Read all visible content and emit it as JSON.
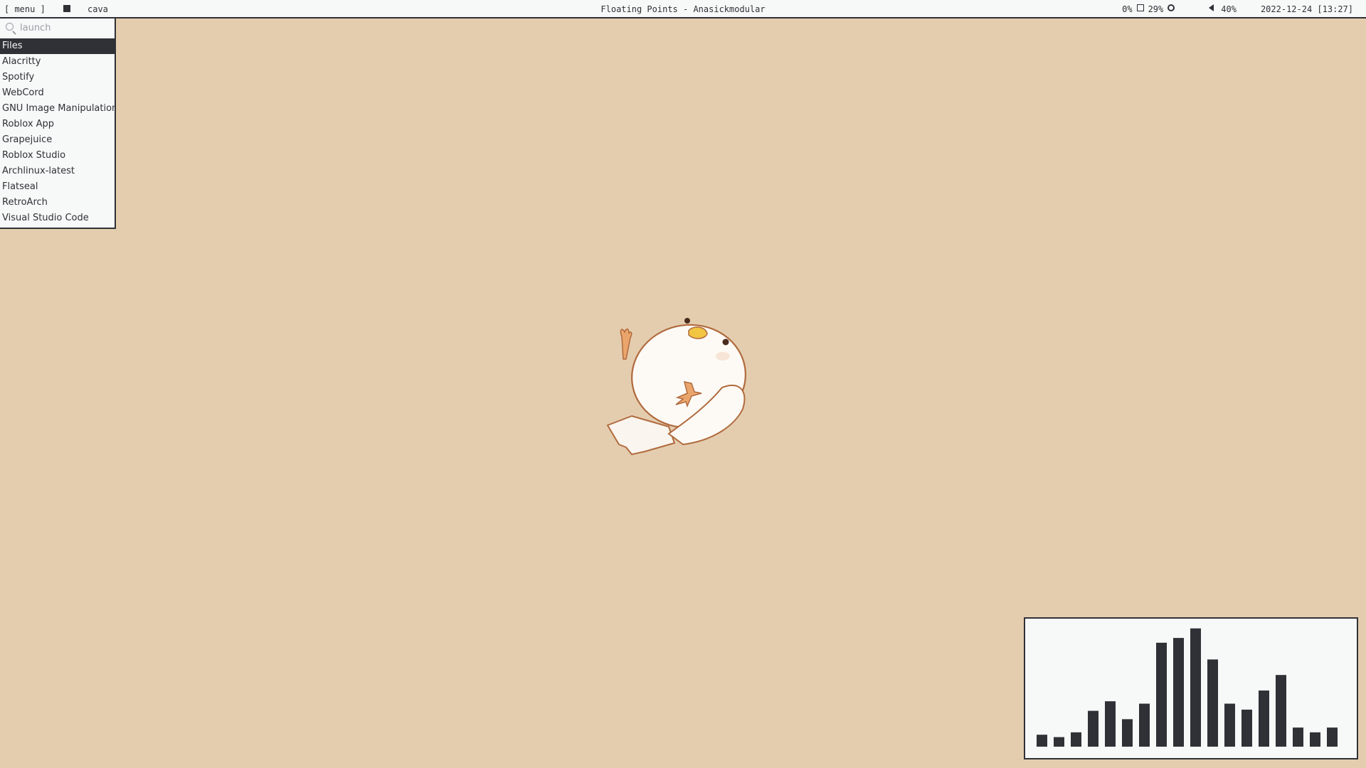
{
  "topbar": {
    "menu_label": "[ menu ]",
    "workspace_label": "cava",
    "now_playing": "Floating Points - Anasickmodular",
    "cpu": "0%",
    "memory": "29%",
    "volume": "40%",
    "datetime": "2022-12-24 [13:27]"
  },
  "launcher": {
    "search_placeholder": "launch",
    "items": [
      {
        "label": "Files",
        "selected": true
      },
      {
        "label": "Alacritty"
      },
      {
        "label": "Spotify"
      },
      {
        "label": "WebCord"
      },
      {
        "label": "GNU Image Manipulation Program"
      },
      {
        "label": "Roblox App"
      },
      {
        "label": "Grapejuice"
      },
      {
        "label": "Roblox Studio"
      },
      {
        "label": "Archlinux-latest"
      },
      {
        "label": "Flatseal"
      },
      {
        "label": "RetroArch"
      },
      {
        "label": "Visual Studio Code"
      }
    ]
  },
  "visualizer": {
    "bar_color": "#2f3136",
    "levels": [
      0.1,
      0.08,
      0.12,
      0.3,
      0.38,
      0.23,
      0.36,
      0.87,
      0.91,
      0.99,
      0.73,
      0.36,
      0.31,
      0.47,
      0.6,
      0.16,
      0.12,
      0.16
    ]
  },
  "colors": {
    "background": "#e4cdae",
    "panel": "#f7f8f8",
    "accent": "#2f3136"
  },
  "wallpaper": {
    "subject": "round-white-chick-illustration"
  }
}
